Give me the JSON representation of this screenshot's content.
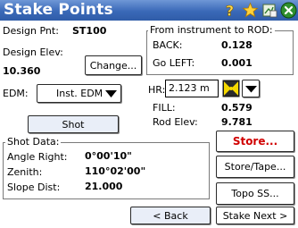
{
  "window": {
    "title": "Stake Points",
    "icons": [
      "help-icon",
      "favorite-star-icon",
      "map-view-icon",
      "close-icon"
    ]
  },
  "design": {
    "point_label": "Design Pnt:",
    "point_value": "ST100",
    "elev_label": "Design Elev:",
    "elev_value": "10.360",
    "change_button": "Change..."
  },
  "edm": {
    "label": "EDM:",
    "selected": "Inst. EDM"
  },
  "shot_button": "Shot",
  "ro": {
    "group_label": "From instrument to ROD:",
    "back_label": "BACK:",
    "back_value": "0.128",
    "left_label": "Go LEFT:",
    "left_value": "0.001"
  },
  "hr": {
    "label": "HR:",
    "value": "2.123 m"
  },
  "fill": {
    "label": "FILL:",
    "value": "0.579"
  },
  "rod_elev": {
    "label": "Rod Elev:",
    "value": "9.781"
  },
  "shot_data": {
    "group_label": "Shot Data:",
    "angle_right_label": "Angle Right:",
    "angle_right_value": "0°00'10\"",
    "zenith_label": "Zenith:",
    "zenith_value": "110°02'00\"",
    "slope_label": "Slope Dist:",
    "slope_value": "21.000"
  },
  "actions": {
    "store": "Store...",
    "store_tape": "Store/Tape...",
    "topo_ss": "Topo SS...",
    "back": "< Back",
    "stake_next": "Stake Next >"
  },
  "colors": {
    "titlebar": "#3a69b8",
    "store_text": "#d00000"
  }
}
